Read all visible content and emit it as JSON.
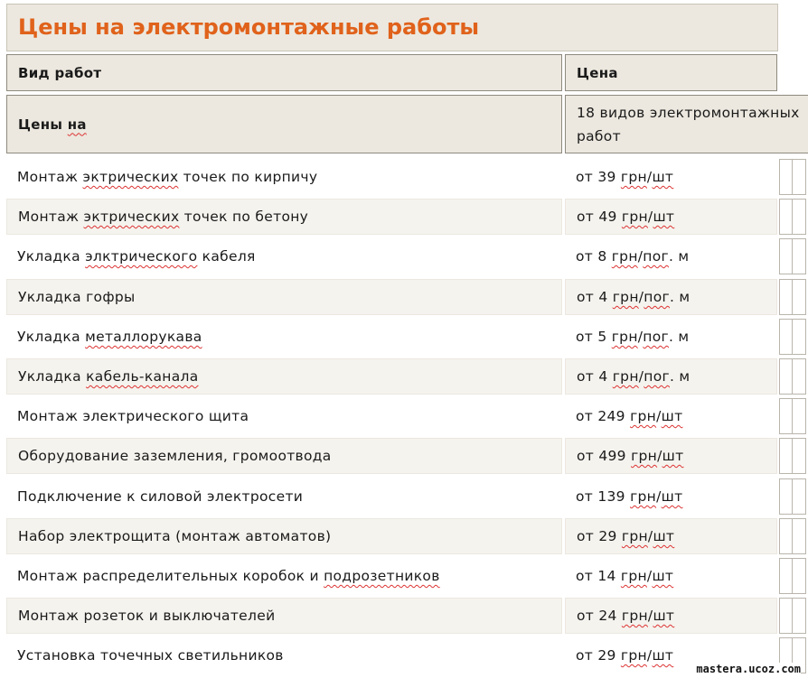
{
  "page_title": "Цены на электромонтажные работы",
  "header": {
    "col_work": "Вид работ",
    "col_price": "Цена"
  },
  "subheader": {
    "label_prefix": "Цены ",
    "label_word": "на",
    "price_line1": "18 видов электромонтажных",
    "price_line2": "работ"
  },
  "rows": [
    {
      "work": [
        "Монтаж ",
        "~эктрических",
        " точек по кирпичу"
      ],
      "price": [
        "от 39 ",
        "~грн",
        "/",
        "~шт"
      ]
    },
    {
      "work": [
        "Монтаж ",
        "~эктрических",
        " точек по бетону"
      ],
      "price": [
        "от 49 ",
        "~грн",
        "/",
        "~шт"
      ]
    },
    {
      "work": [
        "Укладка ",
        "~элктрического",
        " кабеля"
      ],
      "price": [
        "от 8 ",
        "~грн",
        "/",
        "~пог",
        ". м"
      ]
    },
    {
      "work": [
        "Укладка гофры"
      ],
      "price": [
        "от 4 ",
        "~грн",
        "/",
        "~пог",
        ". м"
      ]
    },
    {
      "work": [
        "Укладка ",
        "~металлорукава"
      ],
      "price": [
        "от 5 ",
        "~грн",
        "/",
        "~пог",
        ". м"
      ]
    },
    {
      "work": [
        "Укладка ",
        "~кабель-канала"
      ],
      "price": [
        "от 4 ",
        "~грн",
        "/",
        "~пог",
        ". м"
      ]
    },
    {
      "work": [
        "Монтаж электрического щита"
      ],
      "price": [
        "от 249 ",
        "~грн",
        "/",
        "~шт"
      ]
    },
    {
      "work": [
        "Оборудование заземления, громоотвода"
      ],
      "price": [
        "от 499 ",
        "~грн",
        "/",
        "~шт"
      ]
    },
    {
      "work": [
        "Подключение к силовой электросети"
      ],
      "price": [
        "от 139 ",
        "~грн",
        "/",
        "~шт"
      ]
    },
    {
      "work": [
        "Набор электрощита (монтаж автоматов)"
      ],
      "price": [
        "от 29 ",
        "~грн",
        "/",
        "~шт"
      ]
    },
    {
      "work": [
        "Монтаж распределительных коробок и ",
        "~подрозетников"
      ],
      "price": [
        "от 14 ",
        "~грн",
        "/",
        "~шт"
      ]
    },
    {
      "work": [
        "Монтаж розеток и выключателей"
      ],
      "price": [
        "от 24 ",
        "~грн",
        "/",
        "~шт"
      ]
    },
    {
      "work": [
        "Установка точечных светильников"
      ],
      "price": [
        "от 29 ",
        "~грн",
        "/",
        "~шт"
      ]
    }
  ],
  "watermark": "mastera.ucoz.com",
  "colors": {
    "title": "#e0621b",
    "header_bg": "#ece8df",
    "row_alt_bg": "#f5f3ee",
    "spell_underline": "#d33"
  }
}
